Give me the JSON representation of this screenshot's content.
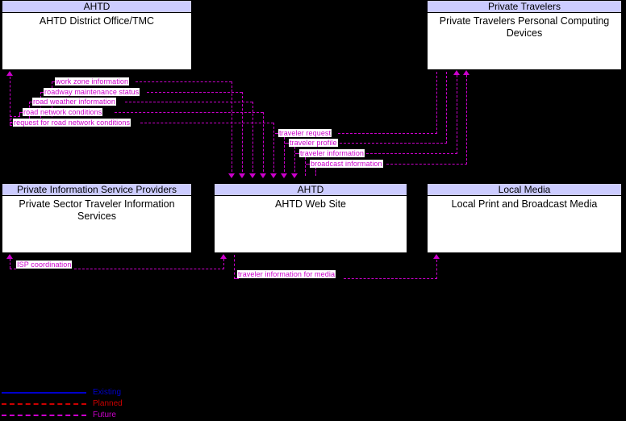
{
  "diagram": {
    "type": "its-architecture-context-diagram",
    "colors": {
      "background": "#000000",
      "box_fill": "#ffffff",
      "box_header_fill": "#ccccff",
      "box_border": "#000000",
      "future_flow": "#cc00cc",
      "existing_flow": "#0000cc",
      "planned_flow": "#cc0000"
    },
    "entities": [
      {
        "id": "ahtd-district-office",
        "stakeholder": "AHTD",
        "name": "AHTD District Office/TMC"
      },
      {
        "id": "private-travelers",
        "stakeholder": "Private Travelers",
        "name": "Private Travelers Personal Computing Devices"
      },
      {
        "id": "private-isp",
        "stakeholder": "Private Information Service Providers",
        "name": "Private Sector Traveler Information Services"
      },
      {
        "id": "ahtd-web-site",
        "stakeholder": "AHTD",
        "name": "AHTD Web Site"
      },
      {
        "id": "local-media",
        "stakeholder": "Local Media",
        "name": "Local Print and Broadcast Media"
      }
    ],
    "flows": [
      {
        "id": "work-zone-information",
        "label": "work zone information"
      },
      {
        "id": "roadway-maintenance-status",
        "label": "roadway maintenance status"
      },
      {
        "id": "road-weather-information",
        "label": "road weather information"
      },
      {
        "id": "road-network-conditions",
        "label": "road network conditions"
      },
      {
        "id": "request-for-road-network-conditions",
        "label": "request for road network conditions"
      },
      {
        "id": "traveler-request",
        "label": "traveler request"
      },
      {
        "id": "traveler-profile",
        "label": "traveler profile"
      },
      {
        "id": "traveler-information",
        "label": "traveler information"
      },
      {
        "id": "broadcast-information",
        "label": "broadcast information"
      },
      {
        "id": "isp-coordination",
        "label": "ISP coordination"
      },
      {
        "id": "traveler-information-for-media",
        "label": "traveler information for media"
      }
    ],
    "legend": [
      {
        "id": "existing",
        "label": "Existing",
        "color": "#0000cc",
        "style": "solid"
      },
      {
        "id": "planned",
        "label": "Planned",
        "color": "#cc0000",
        "style": "dashed"
      },
      {
        "id": "future",
        "label": "Future",
        "color": "#cc00cc",
        "style": "dashed"
      }
    ]
  }
}
